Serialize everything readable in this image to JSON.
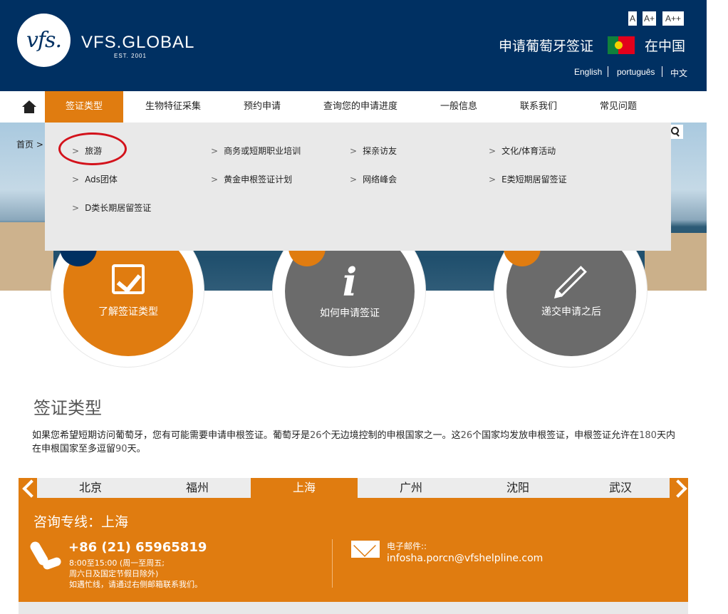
{
  "header": {
    "logo_text": "vfs.",
    "brand": "VFS.GLOBAL",
    "est": "EST. 2001",
    "font_sizes": [
      "A",
      "A+",
      "A++"
    ],
    "title": "申请葡萄牙签证",
    "location": "在中国",
    "languages": [
      "English",
      "português",
      "中文"
    ]
  },
  "nav": {
    "home_icon": "home-icon",
    "items": [
      "签证类型",
      "生物特征采集",
      "预约申请",
      "查询您的申请进度",
      "一般信息",
      "联系我们",
      "常见问题"
    ]
  },
  "breadcrumb": "首页 >",
  "dropdown": {
    "items": [
      "旅游",
      "商务或短期职业培训",
      "探亲访友",
      "文化/体育活动",
      "Ads团体",
      "黄金申根签证计划",
      "网络峰会",
      "E类短期居留签证",
      "D类长期居留签证"
    ]
  },
  "circles": [
    {
      "label": "了解签证类型",
      "icon": "checkbox-icon",
      "color": "#e07c10"
    },
    {
      "label": "如何申请签证",
      "icon": "info-icon",
      "color": "#6b6b6b"
    },
    {
      "label": "递交申请之后",
      "icon": "pencil-icon",
      "color": "#6b6b6b"
    }
  ],
  "section": {
    "title": "签证类型",
    "body_1": "如果您希望短期访问葡萄牙，您有可能需要申请申根签证。葡萄牙是",
    "num_1": "26",
    "body_2": "个无边境控制的申根国家之一。这",
    "num_2": "26",
    "body_3": "个国家均发放申根签证，申根签证允许在",
    "num_3": "180",
    "body_4": "天内在申根国家至多逗留",
    "num_4": "90",
    "body_5": "天。"
  },
  "city_tabs": [
    "北京",
    "福州",
    "上海",
    "广州",
    "沈阳",
    "武汉"
  ],
  "hotline": {
    "title": "咨询专线：上海",
    "phone": "+86 (21) 65965819",
    "hours_1": "8:00至15:00 (周一至周五;",
    "hours_2": "周六日及国定节假日除外)",
    "hours_3": "如遇忙线，请通过右侧邮箱联系我们。",
    "mail_label": "电子邮件::",
    "mail_address": "infosha.porcn@vfshelpline.com"
  },
  "colors": {
    "navy": "#003062",
    "orange": "#e07c10",
    "gray": "#6b6b6b"
  }
}
